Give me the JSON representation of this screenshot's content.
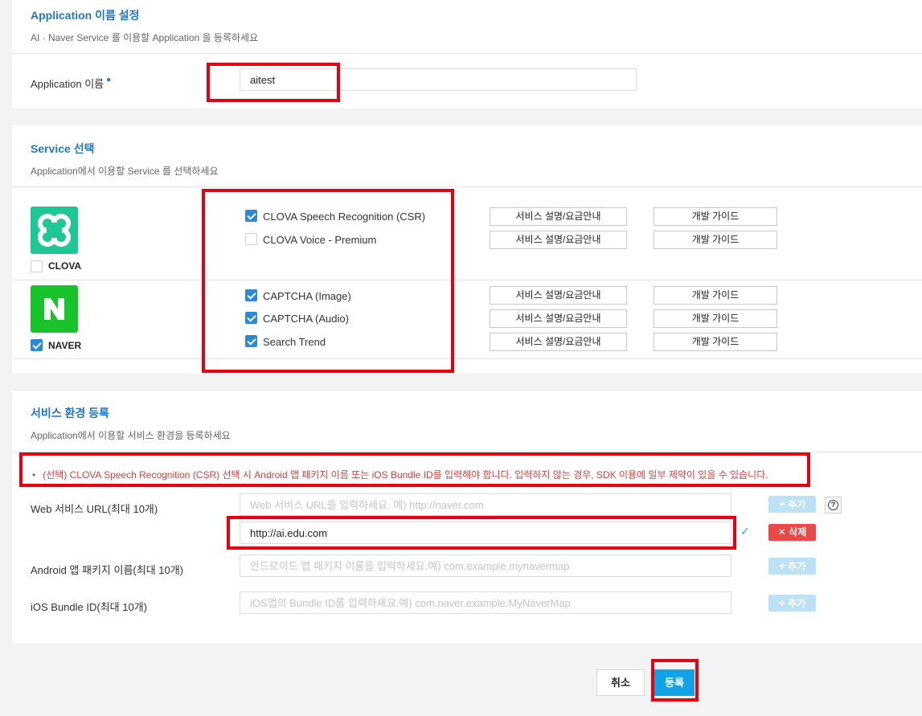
{
  "app_section": {
    "title": "Application 이름 설정",
    "subtitle": "AI · Naver Service 를 이용할 Application 을 등록하세요",
    "name_label": "Application 이름",
    "name_value": "aitest"
  },
  "service_section": {
    "title": "Service 선택",
    "subtitle": "Application에서 이용할 Service 를 선택하세요",
    "desc_label": "서비스 설명/요금안내",
    "guide_label": "개발 가이드",
    "groups": [
      {
        "brand": "CLOVA",
        "brand_checked": false,
        "brand_color": "#1ec896",
        "services": [
          {
            "name": "CLOVA Speech Recognition (CSR)",
            "checked": true
          },
          {
            "name": "CLOVA Voice - Premium",
            "checked": false
          }
        ]
      },
      {
        "brand": "NAVER",
        "brand_checked": true,
        "brand_color": "#19c32c",
        "services": [
          {
            "name": "CAPTCHA (Image)",
            "checked": true
          },
          {
            "name": "CAPTCHA (Audio)",
            "checked": true
          },
          {
            "name": "Search Trend",
            "checked": true
          }
        ]
      }
    ]
  },
  "env_section": {
    "title": "서비스 환경 등록",
    "subtitle": "Application에서 이용할 서비스 환경을 등록하세요",
    "notice_bullet": "•",
    "notice": "(선택) CLOVA Speech Recognition (CSR) 선택 시 Android 앱 패키지 이름 또는 iOS Bundle ID를 입력해야 합니다. 입력하지 않는 경우, SDK 이용에 일부 제약이 있을 수 있습니다.",
    "web_label": "Web 서비스 URL(최대 10개)",
    "web_placeholder": "Web 서비스 URL을 입력하세요. 예) http://naver.com",
    "web_value": "http://ai.edu.com",
    "android_label": "Android 앱 패키지 이름(최대 10개)",
    "android_placeholder": "안드로이드 앱 패키지 이름을 입력하세요.예) com.example.mynavermap",
    "ios_label": "iOS Bundle ID(최대 10개)",
    "ios_placeholder": "iOS앱의 Bundle ID를 입력하세요.예) com.naver.example.MyNaverMap",
    "add_label": "추가",
    "delete_label": "삭제",
    "help_glyph": "?"
  },
  "footer": {
    "cancel_label": "취소",
    "submit_label": "등록"
  },
  "colors": {
    "accent": "#1f78c8",
    "highlight": "#e60012",
    "submit": "#12a2e6",
    "delete": "#e84a4a"
  }
}
